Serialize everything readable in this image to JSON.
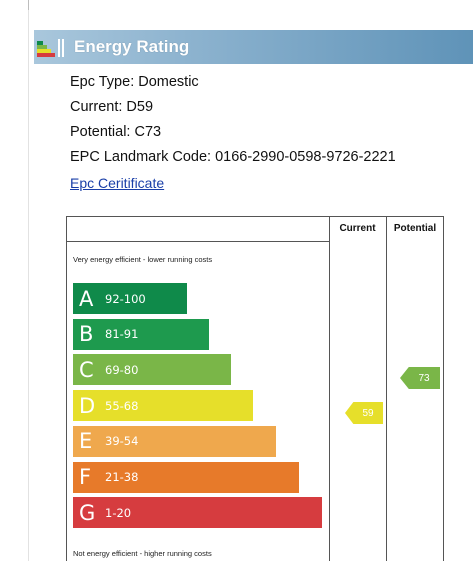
{
  "panel": {
    "title": "Energy Rating",
    "epc_type": "Epc Type: Domestic",
    "current": "Current: D59",
    "potential": "Potential: C73",
    "landmark": "EPC Landmark Code: 0166-2990-0598-9726-2221",
    "certificate_link": "Epc Ceritificate"
  },
  "chart_data": {
    "type": "table",
    "columns": [
      "Current",
      "Potential"
    ],
    "top_caption": "Very energy efficient - lower running costs",
    "bottom_caption": "Not energy efficient - higher running costs",
    "bands": [
      {
        "letter": "A",
        "range": "92-100",
        "color": "#0f8a4a"
      },
      {
        "letter": "B",
        "range": "81-91",
        "color": "#1e9a4e"
      },
      {
        "letter": "C",
        "range": "69-80",
        "color": "#7ab648"
      },
      {
        "letter": "D",
        "range": "55-68",
        "color": "#e6df2a"
      },
      {
        "letter": "E",
        "range": "39-54",
        "color": "#efa84d"
      },
      {
        "letter": "F",
        "range": "21-38",
        "color": "#e77a2a"
      },
      {
        "letter": "G",
        "range": "1-20",
        "color": "#d63c3f"
      }
    ],
    "current_value": "59",
    "current_color": "#e6df2a",
    "potential_value": "73",
    "potential_color": "#7ab648"
  }
}
